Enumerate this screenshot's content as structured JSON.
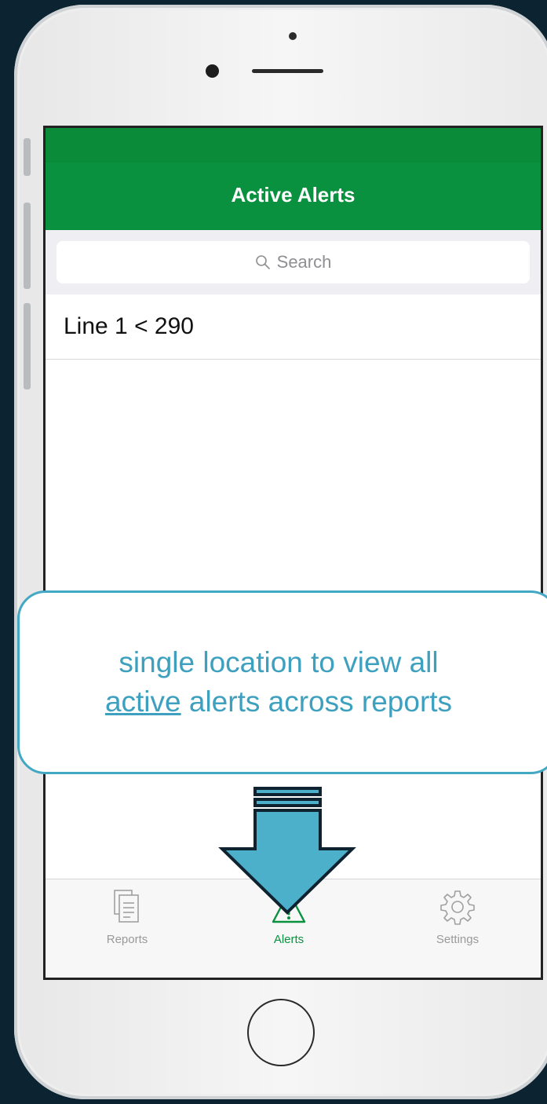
{
  "header": {
    "title": "Active Alerts"
  },
  "search": {
    "placeholder": "Search"
  },
  "alerts": [
    {
      "label": "Line 1 < 290"
    }
  ],
  "tabs": [
    {
      "label": "Reports",
      "icon": "reports-icon",
      "active": false
    },
    {
      "label": "Alerts",
      "icon": "warning-icon",
      "active": true
    },
    {
      "label": "Settings",
      "icon": "gear-icon",
      "active": false
    }
  ],
  "callout": {
    "line1": "single location to view all",
    "line2_underlined": "active",
    "line2_rest": " alerts across reports"
  },
  "colors": {
    "nav_green": "#0a9140",
    "callout_blue": "#43a8c4",
    "background": "#0c2431"
  }
}
